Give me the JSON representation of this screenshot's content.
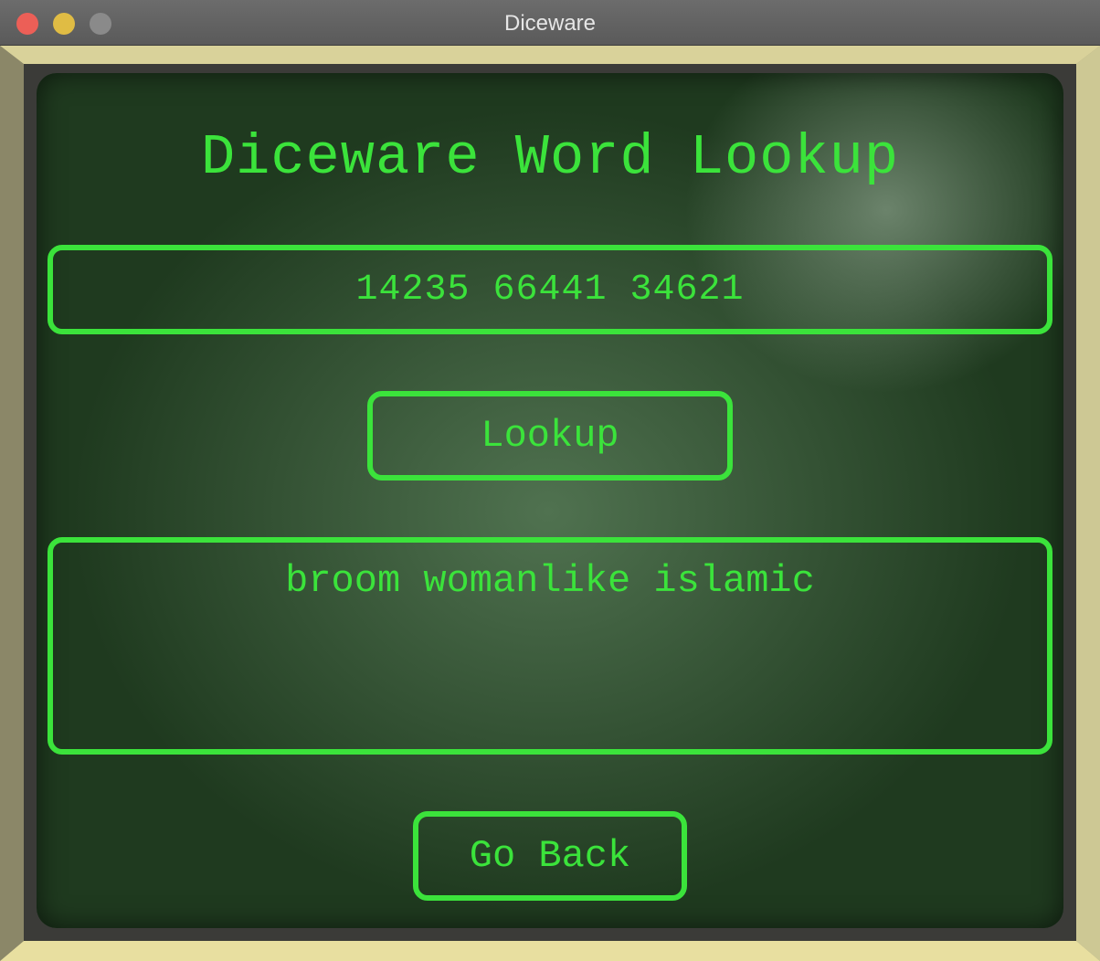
{
  "window": {
    "title": "Diceware"
  },
  "screen": {
    "heading": "Diceware Word Lookup",
    "dice_input": {
      "value": "14235 66441 34621"
    },
    "lookup_button": "Lookup",
    "result_text": "broom womanlike islamic",
    "back_button": "Go Back"
  },
  "colors": {
    "accent": "#3be33b",
    "screen_bg": "#1f3a1f",
    "frame": "#a39f7a"
  }
}
